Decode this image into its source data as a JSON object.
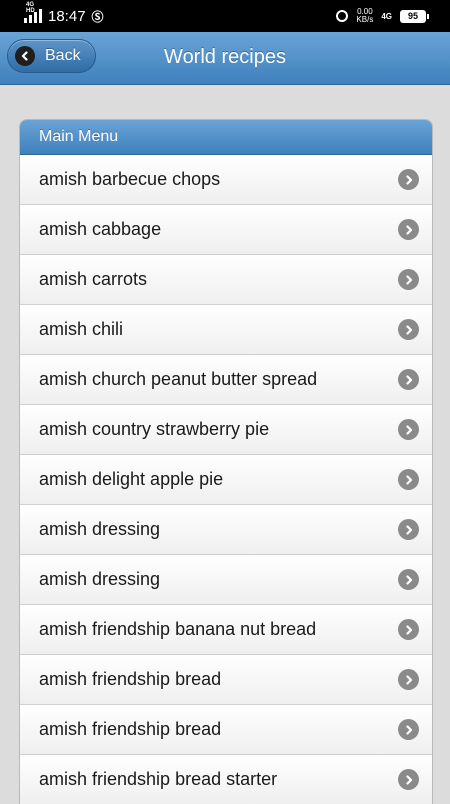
{
  "status_bar": {
    "network": "4G HD",
    "time": "18:47",
    "speed_value": "0.00",
    "speed_unit": "KB/s",
    "mobile": "4G",
    "battery": "95"
  },
  "header": {
    "back_label": "Back",
    "title": "World recipes"
  },
  "list": {
    "divider": "Main Menu",
    "items": [
      "amish barbecue chops",
      "amish cabbage",
      "amish carrots",
      "amish chili",
      "amish church peanut butter spread",
      "amish country strawberry pie",
      "amish delight apple pie",
      "amish dressing",
      "amish dressing",
      "amish friendship banana nut bread",
      "amish friendship bread",
      "amish friendship bread",
      "amish friendship bread starter"
    ]
  },
  "colors": {
    "header": "#4f8fca",
    "background": "#dcdcdc",
    "arrow": "#8a8a8a"
  },
  "icons": {
    "back": "chevron-left-icon",
    "item": "chevron-right-icon"
  }
}
